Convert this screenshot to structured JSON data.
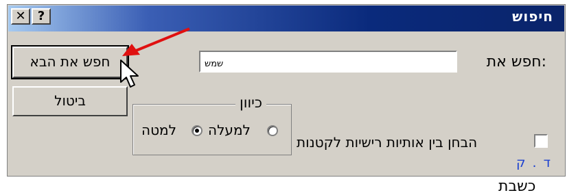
{
  "dialog": {
    "title": "חיפוש",
    "help_glyph": "?",
    "close_glyph": "✕"
  },
  "buttons": {
    "find_next": "חפש את הבא",
    "cancel": "ביטול"
  },
  "find": {
    "label": "חפש את:",
    "value": "שמש"
  },
  "direction": {
    "legend": "כיוון",
    "up": "למעלה",
    "down": "למטה",
    "selected": "down"
  },
  "match_case": {
    "label": "הבחן בין אותיות רישיות לקטנות",
    "checked": false
  },
  "shortcut_text": "ד . ק",
  "below_text": "כשבת",
  "colors": {
    "title_bar": "#0a246a",
    "face": "#d4d0c8",
    "arrow": "#e01010",
    "link": "#1a3fd0"
  }
}
